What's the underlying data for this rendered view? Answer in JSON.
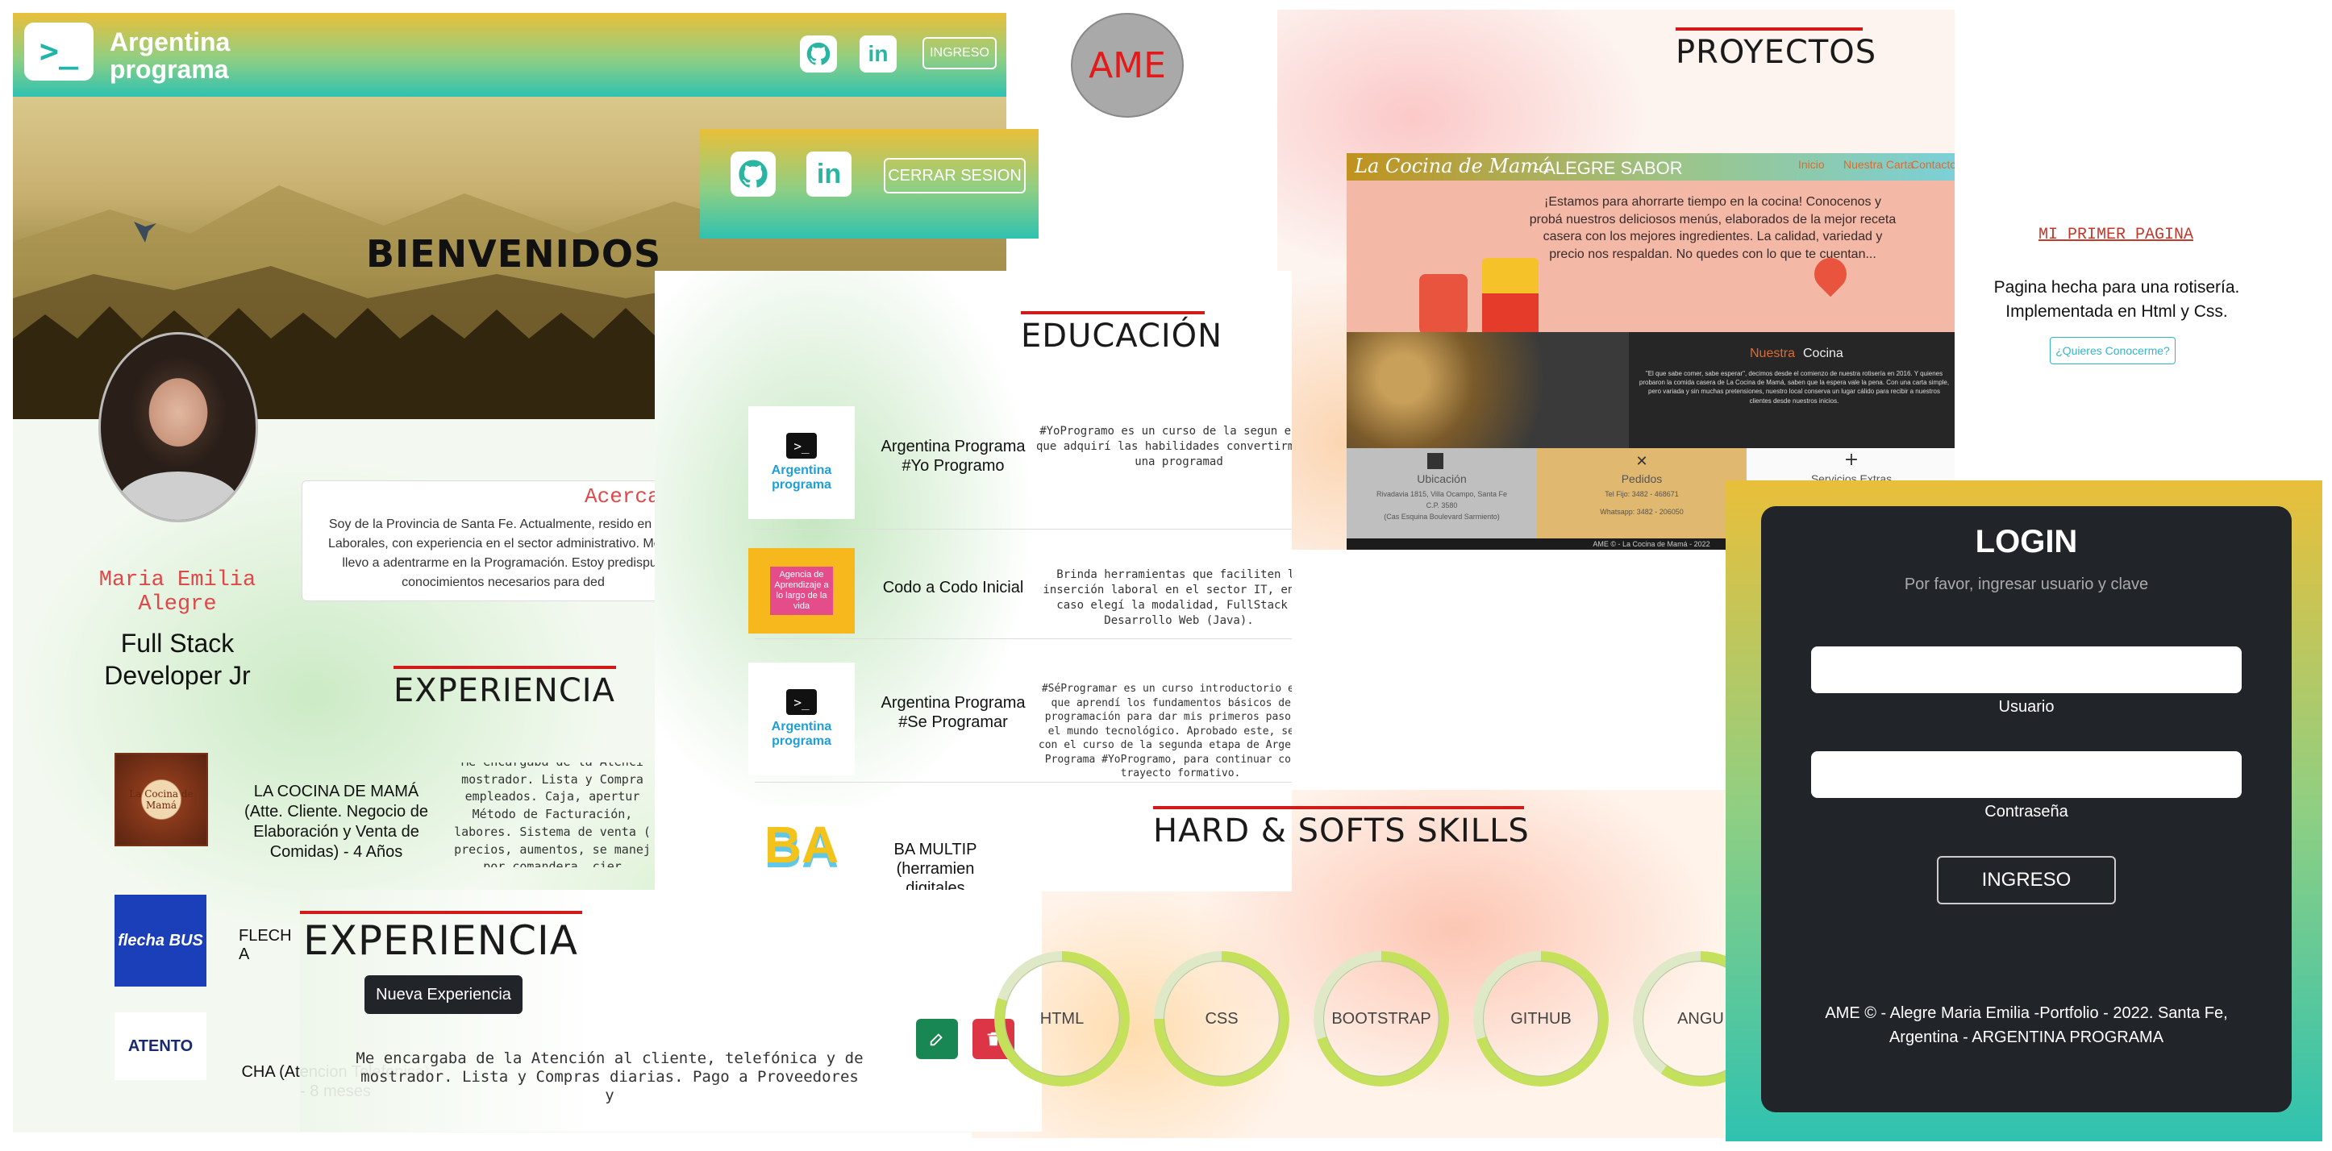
{
  "header": {
    "logo_line1": "Argentina",
    "logo_line2": "programa",
    "login_button": "INGRESO",
    "prompt_glyph": ">_"
  },
  "hero": {
    "title": "BIENVENIDOS"
  },
  "admin_bar": {
    "logout_button": "CERRAR SESION"
  },
  "brand_badge": "AME",
  "profile": {
    "name": "Maria Emilia Alegre",
    "role": "Full Stack Developer Jr",
    "about_title": "Acerca",
    "about_text": "Soy de la Provincia de Santa Fe. Actualmente, resido en la P Laborales, con experiencia en el sector administrativo. Me co llevo a adentrarme en la Programación. Estoy predispue conocimientos necesarios para ded"
  },
  "experience": {
    "title": "EXPERIENCIA",
    "items": [
      {
        "name": "LA COCINA DE MAMÁ (Atte. Cliente. Negocio de Elaboración y Venta de Comidas) - 4 Años",
        "logo": "La Cocina de Mamá",
        "desc": "Me encargaba de la Atenci mostrador. Lista y Compra empleados. Caja, apertur Método de Facturación, labores. Sistema de venta ( precios, aumentos, se manej por comandera, cier"
      },
      {
        "name": "FLECH A",
        "logo": "flecha BUS"
      },
      {
        "name": "CHA (Atencion Telefonica) - 8 meses",
        "logo": "ATENTO"
      }
    ]
  },
  "experience_edit": {
    "title": "EXPERIENCIA",
    "new_button": "Nueva Experiencia",
    "desc": "Me encargaba de la Atención al cliente, telefónica y de mostrador. Lista y Compras diarias. Pago a Proveedores y",
    "edit_icon": "pencil",
    "delete_icon": "trash"
  },
  "education": {
    "title": "EDUCACIÓN",
    "items": [
      {
        "name": "Argentina Programa #Yo Programo",
        "logo_text": "Argentina programa",
        "desc": "#YoProgramo es un curso de la segun en el que adquirí las habilidades convertirme en una programad"
      },
      {
        "name": "Codo a Codo Inicial",
        "logo_text": "Agencia de Aprendizaje a lo largo de la vida",
        "desc": "Brinda herramientas que faciliten la inserción laboral en el sector IT, en mi caso elegí la modalidad, FullStack - Desarrollo Web (Java)."
      },
      {
        "name": "Argentina Programa #Se Programar",
        "logo_text": "Argentina programa",
        "desc": "#SéProgramar es un curso introductorio en el que aprendí los fundamentos básicos de la programación para dar mis primeros pasos en el mundo tecnológico. Aprobado este, seguí con el curso de la segunda etapa de Argentina Programa #YoProgramo, para continuar con mi trayecto formativo."
      },
      {
        "name": "BA MULTIP (herramien digitales",
        "logo_text": "BA",
        "desc": ""
      }
    ]
  },
  "skills": {
    "title": "HARD & SOFTS SKILLS",
    "items": [
      {
        "label": "HTML",
        "percent": 80
      },
      {
        "label": "CSS",
        "percent": 75
      },
      {
        "label": "BOOTSTRAP",
        "percent": 70
      },
      {
        "label": "GITHUB",
        "percent": 70
      },
      {
        "label": "ANGU",
        "percent": 60
      }
    ]
  },
  "projects": {
    "title": "PROYECTOS",
    "site": {
      "brand": "La Cocina de Mamá",
      "brand_suffix": "- ALEGRE SABOR",
      "nav": [
        "Inicio",
        "Nuestra Carta",
        "Contacto"
      ],
      "hero_text": "¡Estamos para ahorrarte tiempo en la cocina! Conocenos y probá nuestros deliciosos menús, elaborados de la mejor receta casera con los mejores ingredientes. La calidad, variedad y precio nos respaldan. No quedes con lo que te cuentan...",
      "kitchen_title_a": "Nuestra",
      "kitchen_title_b": "Cocina",
      "kitchen_text": "\"El que sabe comer, sabe esperar\", decimos desde el comienzo de nuestra rotisería en 2016. Y quienes probaron la comida casera de La Cocina de Mamá, saben que la espera vale la pena. Con una carta simple, pero variada y sin muchas pretensiones, nuestro local conserva un lugar cálido para recibir a nuestros clientes desde nuestros inicios.",
      "cols": [
        {
          "title": "Ubicación",
          "lines": [
            "Rivadavia 1815, Villa Ocampo, Santa Fe",
            "C.P. 3580",
            "(Cas Esquina Boulevard Sarmiento)"
          ]
        },
        {
          "title": "Pedidos",
          "lines": [
            "Tel Fijo: 3482 - 468671",
            "Whatsapp: 3482 - 206050"
          ]
        },
        {
          "title": "Servicios Extras",
          "lines": []
        }
      ],
      "footer": "AME © - La Cocina de Mamá - 2022"
    },
    "first_page": {
      "title": "MI PRIMER PAGINA",
      "text": "Pagina hecha para una rotisería. Implementada en Html y Css.",
      "button": "¿Quieres Conocerme?"
    }
  },
  "login": {
    "title": "LOGIN",
    "subtitle": "Por favor, ingresar usuario y clave",
    "user_label": "Usuario",
    "password_label": "Contraseña",
    "submit": "INGRESO",
    "footer": "AME © - Alegre Maria Emilia -Portfolio - 2022. Santa Fe, Argentina - ARGENTINA PROGRAMA"
  }
}
